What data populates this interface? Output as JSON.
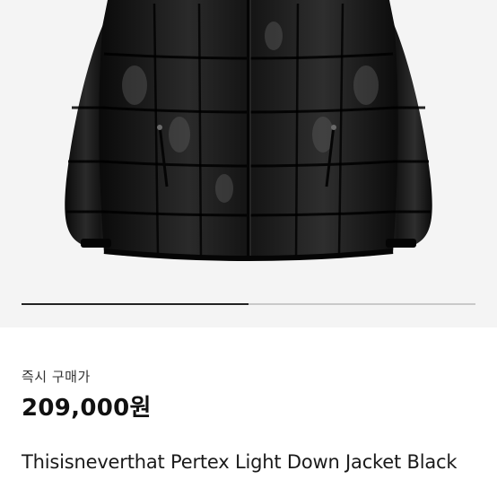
{
  "product": {
    "image_icon": "puffer-jacket-photo",
    "image_colors": {
      "jacket": "#111111",
      "background": "#f4f4f4"
    },
    "gallery_progress": 0.5,
    "purchase_type": "즉시 구매가",
    "price": "209,000원",
    "title": "Thisisneverthat Pertex Light Down Jacket Black"
  }
}
